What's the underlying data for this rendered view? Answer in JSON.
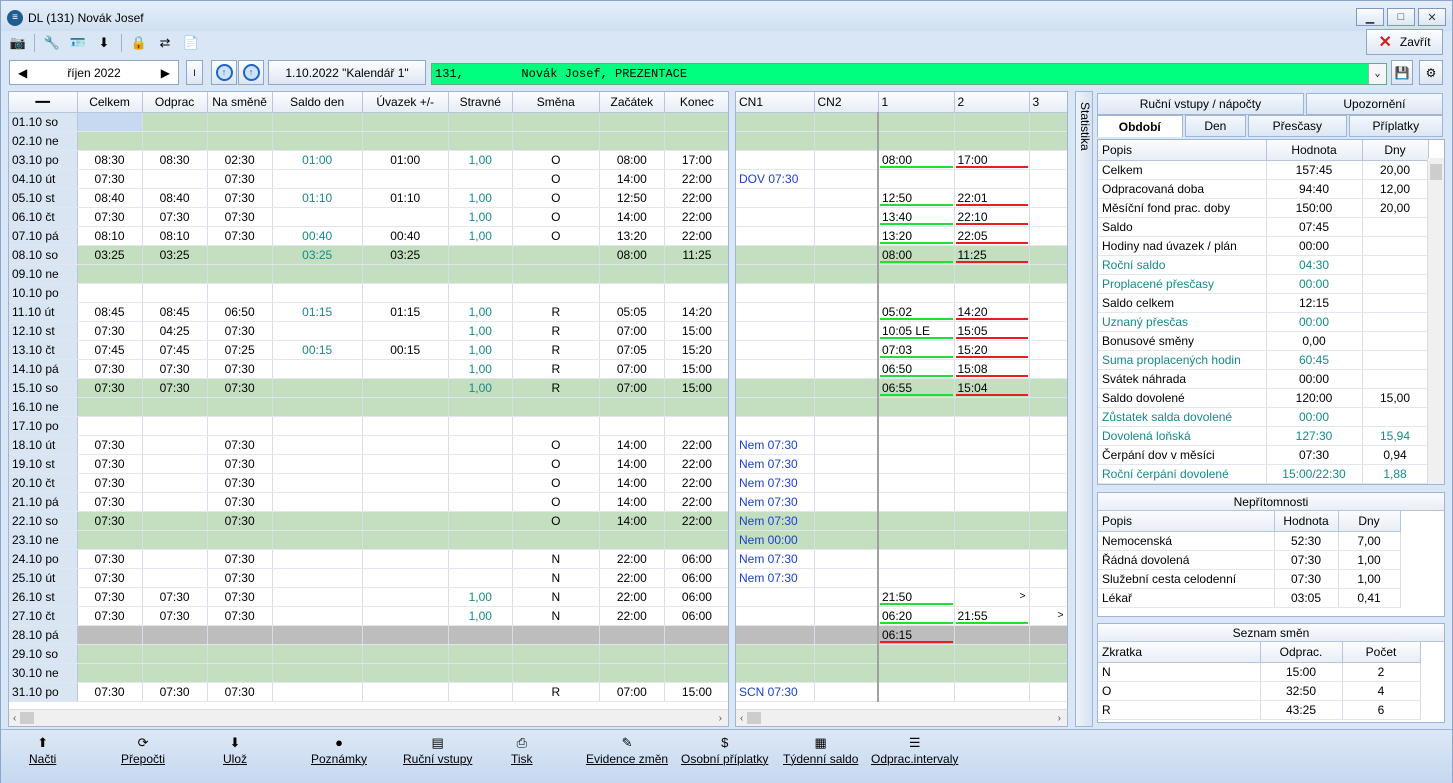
{
  "window": {
    "title": "DL (131) Novák Josef",
    "close_label": "Zavřít"
  },
  "nav": {
    "month": "říjen 2022",
    "i_label": "I",
    "calendar_label": "1.10.2022  \"Kalendář 1\"",
    "employee": "131,        Novák Josef, PREZENTACE"
  },
  "grid": {
    "headers": [
      "Celkem",
      "Odprac",
      "Na směně",
      "Saldo den",
      "Úvazek +/-",
      "Stravné",
      "Směna",
      "Začátek",
      "Konec"
    ],
    "date_header": "",
    "rows": [
      {
        "d": "01.10 so",
        "t": "we",
        "v": [
          "",
          "",
          "",
          "",
          "",
          "",
          "",
          "",
          ""
        ]
      },
      {
        "d": "02.10 ne",
        "t": "we",
        "v": [
          "",
          "",
          "",
          "",
          "",
          "",
          "",
          "",
          ""
        ]
      },
      {
        "d": "03.10 po",
        "t": "",
        "v": [
          "08:30",
          "08:30",
          "02:30",
          "01:00",
          "01:00",
          "1,00",
          "O",
          "08:00",
          "17:00"
        ]
      },
      {
        "d": "04.10 út",
        "t": "",
        "v": [
          "07:30",
          "",
          "07:30",
          "",
          "",
          "",
          "O",
          "14:00",
          "22:00"
        ]
      },
      {
        "d": "05.10 st",
        "t": "",
        "v": [
          "08:40",
          "08:40",
          "07:30",
          "01:10",
          "01:10",
          "1,00",
          "O",
          "12:50",
          "22:00"
        ]
      },
      {
        "d": "06.10 čt",
        "t": "",
        "v": [
          "07:30",
          "07:30",
          "07:30",
          "",
          "",
          "1,00",
          "O",
          "14:00",
          "22:00"
        ]
      },
      {
        "d": "07.10 pá",
        "t": "",
        "v": [
          "08:10",
          "08:10",
          "07:30",
          "00:40",
          "00:40",
          "1,00",
          "O",
          "13:20",
          "22:00"
        ]
      },
      {
        "d": "08.10 so",
        "t": "we",
        "v": [
          "03:25",
          "03:25",
          "",
          "03:25",
          "03:25",
          "",
          "",
          "08:00",
          "11:25"
        ]
      },
      {
        "d": "09.10 ne",
        "t": "we",
        "v": [
          "",
          "",
          "",
          "",
          "",
          "",
          "",
          "",
          ""
        ]
      },
      {
        "d": "10.10 po",
        "t": "",
        "v": [
          "",
          "",
          "",
          "",
          "",
          "",
          "",
          "",
          ""
        ]
      },
      {
        "d": "11.10 út",
        "t": "",
        "v": [
          "08:45",
          "08:45",
          "06:50",
          "01:15",
          "01:15",
          "1,00",
          "R",
          "05:05",
          "14:20"
        ]
      },
      {
        "d": "12.10 st",
        "t": "",
        "v": [
          "07:30",
          "04:25",
          "07:30",
          "",
          "",
          "1,00",
          "R",
          "07:00",
          "15:00"
        ]
      },
      {
        "d": "13.10 čt",
        "t": "",
        "v": [
          "07:45",
          "07:45",
          "07:25",
          "00:15",
          "00:15",
          "1,00",
          "R",
          "07:05",
          "15:20"
        ]
      },
      {
        "d": "14.10 pá",
        "t": "",
        "v": [
          "07:30",
          "07:30",
          "07:30",
          "",
          "",
          "1,00",
          "R",
          "07:00",
          "15:00"
        ]
      },
      {
        "d": "15.10 so",
        "t": "we",
        "v": [
          "07:30",
          "07:30",
          "07:30",
          "",
          "",
          "1,00",
          "R",
          "07:00",
          "15:00"
        ]
      },
      {
        "d": "16.10 ne",
        "t": "we",
        "v": [
          "",
          "",
          "",
          "",
          "",
          "",
          "",
          "",
          ""
        ]
      },
      {
        "d": "17.10 po",
        "t": "",
        "v": [
          "",
          "",
          "",
          "",
          "",
          "",
          "",
          "",
          ""
        ]
      },
      {
        "d": "18.10 út",
        "t": "",
        "v": [
          "07:30",
          "",
          "07:30",
          "",
          "",
          "",
          "O",
          "14:00",
          "22:00"
        ]
      },
      {
        "d": "19.10 st",
        "t": "",
        "v": [
          "07:30",
          "",
          "07:30",
          "",
          "",
          "",
          "O",
          "14:00",
          "22:00"
        ]
      },
      {
        "d": "20.10 čt",
        "t": "",
        "v": [
          "07:30",
          "",
          "07:30",
          "",
          "",
          "",
          "O",
          "14:00",
          "22:00"
        ]
      },
      {
        "d": "21.10 pá",
        "t": "",
        "v": [
          "07:30",
          "",
          "07:30",
          "",
          "",
          "",
          "O",
          "14:00",
          "22:00"
        ]
      },
      {
        "d": "22.10 so",
        "t": "we",
        "v": [
          "07:30",
          "",
          "07:30",
          "",
          "",
          "",
          "O",
          "14:00",
          "22:00"
        ]
      },
      {
        "d": "23.10 ne",
        "t": "we",
        "v": [
          "",
          "",
          "",
          "",
          "",
          "",
          "",
          "",
          ""
        ]
      },
      {
        "d": "24.10 po",
        "t": "",
        "v": [
          "07:30",
          "",
          "07:30",
          "",
          "",
          "",
          "N",
          "22:00",
          "06:00"
        ]
      },
      {
        "d": "25.10 út",
        "t": "",
        "v": [
          "07:30",
          "",
          "07:30",
          "",
          "",
          "",
          "N",
          "22:00",
          "06:00"
        ]
      },
      {
        "d": "26.10 st",
        "t": "",
        "v": [
          "07:30",
          "07:30",
          "07:30",
          "",
          "",
          "1,00",
          "N",
          "22:00",
          "06:00"
        ]
      },
      {
        "d": "27.10 čt",
        "t": "",
        "v": [
          "07:30",
          "07:30",
          "07:30",
          "",
          "",
          "1,00",
          "N",
          "22:00",
          "06:00"
        ]
      },
      {
        "d": "28.10 pá",
        "t": "gray",
        "v": [
          "",
          "",
          "",
          "",
          "",
          "",
          "",
          "",
          ""
        ]
      },
      {
        "d": "29.10 so",
        "t": "we",
        "v": [
          "",
          "",
          "",
          "",
          "",
          "",
          "",
          "",
          ""
        ]
      },
      {
        "d": "30.10 ne",
        "t": "we",
        "v": [
          "",
          "",
          "",
          "",
          "",
          "",
          "",
          "",
          ""
        ]
      },
      {
        "d": "31.10 po",
        "t": "",
        "v": [
          "07:30",
          "07:30",
          "07:30",
          "",
          "",
          "",
          "R",
          "07:00",
          "15:00"
        ]
      }
    ]
  },
  "grid2": {
    "headers": [
      "CN1",
      "CN2",
      "1",
      "2",
      "3"
    ],
    "rows": [
      [
        "",
        "",
        "",
        "",
        ""
      ],
      [
        "",
        "",
        "",
        "",
        ""
      ],
      [
        "",
        "",
        "08:00",
        "17:00",
        ""
      ],
      [
        "DOV 07:30",
        "",
        "",
        "",
        ""
      ],
      [
        "",
        "",
        "12:50",
        "22:01",
        ""
      ],
      [
        "",
        "",
        "13:40",
        "22:10",
        ""
      ],
      [
        "",
        "",
        "13:20",
        "22:05",
        ""
      ],
      [
        "",
        "",
        "08:00",
        "11:25",
        ""
      ],
      [
        "",
        "",
        "",
        "",
        ""
      ],
      [
        "",
        "",
        "",
        "",
        ""
      ],
      [
        "",
        "",
        "05:02",
        "14:20",
        ""
      ],
      [
        "",
        "",
        "10:05  LE",
        "15:05",
        ""
      ],
      [
        "",
        "",
        "07:03",
        "15:20",
        ""
      ],
      [
        "",
        "",
        "06:50",
        "15:08",
        ""
      ],
      [
        "",
        "",
        "06:55",
        "15:04",
        ""
      ],
      [
        "",
        "",
        "",
        "",
        ""
      ],
      [
        "",
        "",
        "",
        "",
        ""
      ],
      [
        "Nem 07:30",
        "",
        "",
        "",
        ""
      ],
      [
        "Nem 07:30",
        "",
        "",
        "",
        ""
      ],
      [
        "Nem 07:30",
        "",
        "",
        "",
        ""
      ],
      [
        "Nem 07:30",
        "",
        "",
        "",
        ""
      ],
      [
        "Nem 07:30",
        "",
        "",
        "",
        ""
      ],
      [
        "Nem 00:00",
        "",
        "",
        "",
        ""
      ],
      [
        "Nem 07:30",
        "",
        "",
        "",
        ""
      ],
      [
        "Nem 07:30",
        "",
        "",
        "",
        ""
      ],
      [
        "",
        "",
        "21:50",
        ">",
        ""
      ],
      [
        "",
        "",
        "06:20",
        "21:55",
        ">"
      ],
      [
        "",
        "",
        "06:15",
        "",
        ""
      ],
      [
        "",
        "",
        "",
        "",
        ""
      ],
      [
        "",
        "",
        "",
        "",
        ""
      ],
      [
        "SCN 07:30",
        "",
        "",
        "",
        ""
      ]
    ]
  },
  "stat_label": "Statistika",
  "tabs_row1": [
    "Ruční vstupy / nápočty",
    "Upozornění"
  ],
  "tabs_row2": [
    "Období",
    "Den",
    "Přesčasy",
    "Příplatky"
  ],
  "period": {
    "headers": [
      "Popis",
      "Hodnota",
      "Dny"
    ],
    "rows": [
      {
        "p": "Celkem",
        "h": "157:45",
        "d": "20,00",
        "c": ""
      },
      {
        "p": "Odpracovaná doba",
        "h": "94:40",
        "d": "12,00",
        "c": ""
      },
      {
        "p": "Měsíční fond prac. doby",
        "h": "150:00",
        "d": "20,00",
        "c": ""
      },
      {
        "p": "Saldo",
        "h": "07:45",
        "d": "",
        "c": ""
      },
      {
        "p": "Hodiny nad úvazek / plán",
        "h": "00:00",
        "d": "",
        "c": ""
      },
      {
        "p": "Roční saldo",
        "h": "04:30",
        "d": "",
        "c": "teal"
      },
      {
        "p": "Proplacené přesčasy",
        "h": "00:00",
        "d": "",
        "c": "teal"
      },
      {
        "p": "Saldo celkem",
        "h": "12:15",
        "d": "",
        "c": ""
      },
      {
        "p": "Uznaný přesčas",
        "h": "00:00",
        "d": "",
        "c": "teal"
      },
      {
        "p": "Bonusové směny",
        "h": "0,00",
        "d": "",
        "c": ""
      },
      {
        "p": "Suma proplacených hodin",
        "h": "60:45",
        "d": "",
        "c": "teal"
      },
      {
        "p": "Svátek náhrada",
        "h": "00:00",
        "d": "",
        "c": ""
      },
      {
        "p": "Saldo dovolené",
        "h": "120:00",
        "d": "15,00",
        "c": ""
      },
      {
        "p": "Zůstatek salda dovolené",
        "h": "00:00",
        "d": "",
        "c": "teal"
      },
      {
        "p": "Dovolená loňská",
        "h": "127:30",
        "d": "15,94",
        "c": "teal"
      },
      {
        "p": "Čerpání dov v měsíci",
        "h": "07:30",
        "d": "0,94",
        "c": ""
      },
      {
        "p": "Roční čerpání dovolené",
        "h": "15:00/22:30",
        "d": "1,88",
        "c": "teal"
      }
    ]
  },
  "absence": {
    "title": "Nepřítomnosti",
    "headers": [
      "Popis",
      "Hodnota",
      "Dny"
    ],
    "rows": [
      [
        "Nemocenská",
        "52:30",
        "7,00"
      ],
      [
        "Řádná dovolená",
        "07:30",
        "1,00"
      ],
      [
        "Služební cesta celodenní",
        "07:30",
        "1,00"
      ],
      [
        "Lékař",
        "03:05",
        "0,41"
      ]
    ]
  },
  "shifts": {
    "title": "Seznam směn",
    "headers": [
      "Zkratka",
      "Odprac.",
      "Počet"
    ],
    "rows": [
      [
        "N",
        "15:00",
        "2"
      ],
      [
        "O",
        "32:50",
        "4"
      ],
      [
        "R",
        "43:25",
        "6"
      ]
    ]
  },
  "bottom": [
    "Načti",
    "Přepočti",
    "Ulož",
    "Poznámky",
    "Ruční vstupy",
    "Tisk",
    "Evidence změn",
    "Osobní příplatky",
    "Týdenní saldo",
    "Odprac.intervaly"
  ]
}
